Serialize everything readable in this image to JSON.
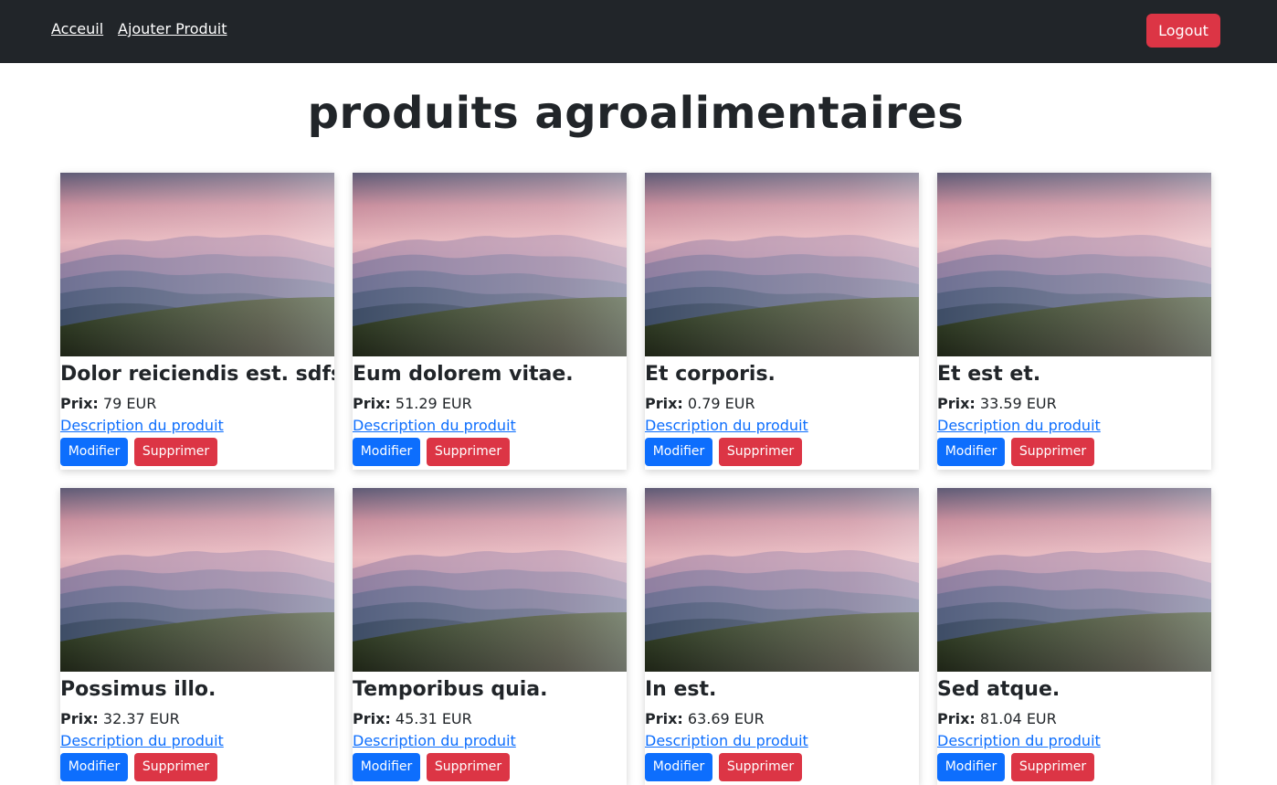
{
  "nav": {
    "home_label": "Acceuil",
    "add_label": "Ajouter Produit",
    "logout_label": "Logout"
  },
  "page": {
    "title": "produits agroalimentaires"
  },
  "labels": {
    "price_prefix": "Prix:",
    "description_link": "Description du produit",
    "edit_button": "Modifier",
    "delete_button": "Supprimer"
  },
  "products": [
    {
      "name": "Dolor reiciendis est. sdfs",
      "price": "79 EUR"
    },
    {
      "name": "Eum dolorem vitae.",
      "price": "51.29 EUR"
    },
    {
      "name": "Et corporis.",
      "price": "0.79 EUR"
    },
    {
      "name": "Et est et.",
      "price": "33.59 EUR"
    },
    {
      "name": "Possimus illo.",
      "price": "32.37 EUR"
    },
    {
      "name": "Temporibus quia.",
      "price": "45.31 EUR"
    },
    {
      "name": "In est.",
      "price": "63.69 EUR"
    },
    {
      "name": "Sed atque.",
      "price": "81.04 EUR"
    }
  ],
  "colors": {
    "navbar_bg": "#212529",
    "primary": "#0d6efd",
    "danger": "#dc3545",
    "text": "#212529"
  }
}
